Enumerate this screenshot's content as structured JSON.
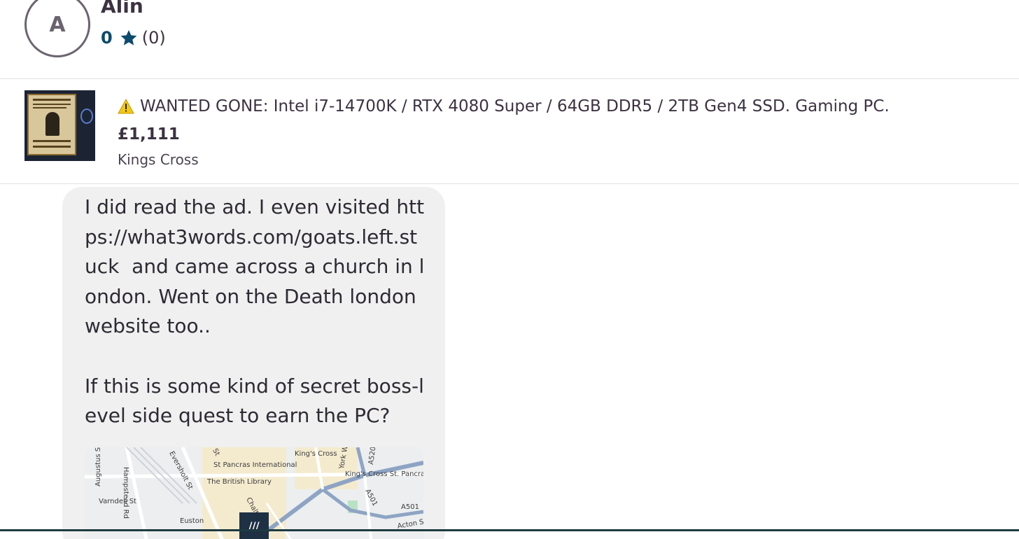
{
  "header": {
    "avatar_letter": "A",
    "username": "Alin",
    "rating_score": "0",
    "rating_count": "(0)",
    "icons": {
      "rating": "star-icon"
    }
  },
  "listing": {
    "title": "WANTED GONE: Intel i7-14700K / RTX 4080 Super / 64GB DDR5 / 2TB Gen4 SSD. Gaming PC.",
    "price": "£1,111",
    "location": "Kings Cross",
    "icons": {
      "title_prefix": "warning-icon"
    }
  },
  "message": {
    "text": "I did read the ad. I even visited https://what3words.com/goats.left.stuck  and came across a church in london. Went on the Death london website too..\n\nIf this is some kind of secret boss-level side quest to earn the PC?",
    "map": {
      "labels": {
        "kings_cross": "King's Cross",
        "st_pancras_intl": "St Pancras International",
        "kings_cross_st_pancras": "King's Cross St. Pancras",
        "british_library": "The British Library",
        "euston": "Euston",
        "varndell": "Varndell St",
        "hampstead": "Hampstead Rd",
        "eversholt": "Eversholt St",
        "augustus": "Augustus St",
        "york_way": "York W",
        "a501": "A501",
        "a520": "A520",
        "acton": "Acton St",
        "chalton": "Chalton",
        "ossulston": "St",
        "pin_text": "///"
      }
    }
  },
  "colors": {
    "accent": "#0c4a6e",
    "text": "#3c3241",
    "bubble": "#f0f0f0",
    "map_bg": "#eceeef",
    "road": "#8ea4c4"
  }
}
